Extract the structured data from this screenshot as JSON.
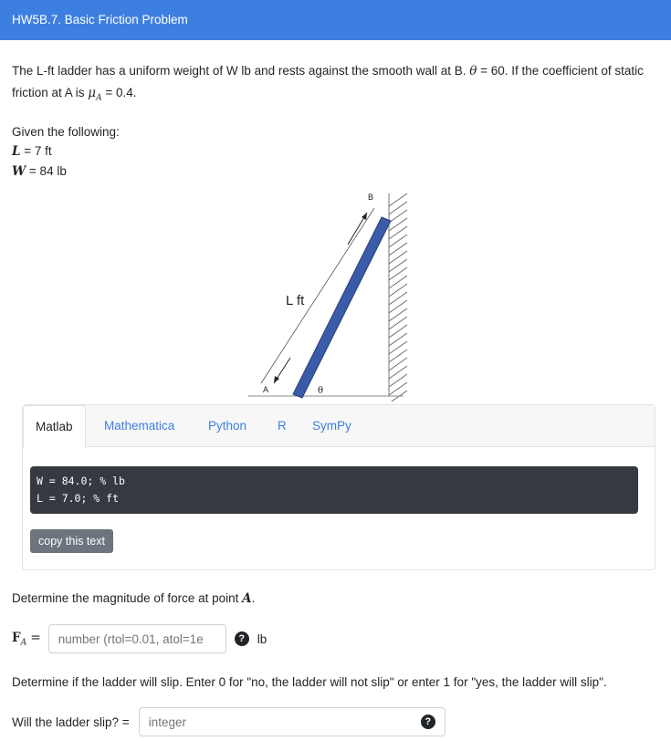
{
  "header": {
    "title": "HW5B.7. Basic Friction Problem"
  },
  "intro": {
    "text_start": "The L-ft ladder has a uniform weight of W lb and rests against the smooth wall at B. ",
    "theta_symbol": "θ",
    "text_mid": " = 60. If the coefficient of static friction at A is ",
    "mu_symbol": "μ",
    "mu_sub": "A",
    "text_end": " = 0.4."
  },
  "given": {
    "heading": "Given the following:",
    "L_symbol": "L",
    "L_value": " = 7 ft",
    "W_symbol": "W",
    "W_value": " = 84 lb"
  },
  "figure": {
    "label_B": "B",
    "label_A": "A",
    "label_L": "L ft",
    "label_theta": "θ",
    "colors": {
      "ladder": "#3a5ba8",
      "hatch": "#555555"
    }
  },
  "tabs": {
    "items": [
      "Matlab",
      "Mathematica",
      "Python",
      "R",
      "SymPy"
    ],
    "active": "Matlab",
    "code_lines": [
      "W = 84.0; % lb",
      "L = 7.0; % ft"
    ],
    "copy_label": "copy this text"
  },
  "question1": {
    "text": "Determine the magnitude of force at point ",
    "point": "A",
    "period": ".",
    "label_F": "F",
    "label_sub": "A",
    "label_eq": " =",
    "placeholder": "number (rtol=0.01, atol=1e",
    "unit": "lb",
    "help": "?"
  },
  "question2": {
    "text": "Determine if the ladder will slip. Enter 0 for \"no, the ladder will not slip\" or enter 1 for \"yes, the ladder will slip\".",
    "label": "Will the ladder slip? =",
    "placeholder": "integer",
    "help": "?"
  }
}
